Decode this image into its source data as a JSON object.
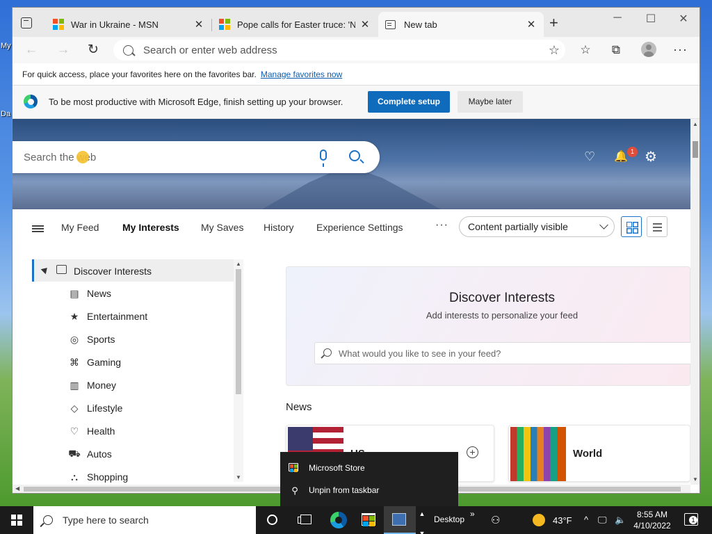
{
  "desktop": {
    "labels": [
      "My",
      "Da"
    ]
  },
  "tabs": [
    {
      "label": "War in Ukraine - MSN",
      "close": "✕"
    },
    {
      "label": "Pope calls for Easter truce: 'No v",
      "close": "✕"
    },
    {
      "label": "New tab",
      "close": "✕"
    }
  ],
  "window_controls": {
    "new_tab": "+",
    "minimize": "─",
    "maximize": "☐",
    "close": "✕"
  },
  "toolbar": {
    "back": "←",
    "forward": "→",
    "refresh": "↻",
    "address_placeholder": "Search or enter web address",
    "add_favorite": "☆",
    "favorites": "☆",
    "collections": "⧉",
    "more": "···"
  },
  "favbar": {
    "text": "For quick access, place your favorites here on the favorites bar.",
    "link": "Manage favorites now"
  },
  "infobar": {
    "message": "To be most productive with Microsoft Edge, finish setting up your browser.",
    "primary": "Complete setup",
    "secondary": "Maybe later"
  },
  "hero": {
    "search_placeholder": "Search the web",
    "rewards_icon": "♡",
    "bell_icon": "🔔",
    "notification_count": "1",
    "settings_icon": "⚙"
  },
  "feednav": {
    "items": [
      "My Feed",
      "My Interests",
      "My Saves",
      "History",
      "Experience Settings"
    ],
    "more": "···",
    "content_visibility": "Content partially visible"
  },
  "sidebar": {
    "header": "Discover Interests",
    "items": [
      {
        "icon": "▤",
        "label": "News"
      },
      {
        "icon": "★",
        "label": "Entertainment"
      },
      {
        "icon": "◎",
        "label": "Sports"
      },
      {
        "icon": "⌘",
        "label": "Gaming"
      },
      {
        "icon": "▥",
        "label": "Money"
      },
      {
        "icon": "◇",
        "label": "Lifestyle"
      },
      {
        "icon": "♡",
        "label": "Health"
      },
      {
        "icon": "⛟",
        "label": "Autos"
      },
      {
        "icon": "⛬",
        "label": "Shopping"
      }
    ]
  },
  "discover": {
    "title": "Discover Interests",
    "subtitle": "Add interests to personalize your feed",
    "search_placeholder": "What would you like to see in your feed?"
  },
  "news": {
    "section": "News",
    "cards": [
      {
        "name": "US",
        "add": "+"
      },
      {
        "name": "World"
      }
    ]
  },
  "jumplist": {
    "items": [
      {
        "label": "Microsoft Store"
      },
      {
        "icon": "⚲",
        "label": "Unpin from taskbar"
      }
    ]
  },
  "taskbar": {
    "search_placeholder": "Type here to search",
    "desktop_label": "Desktop",
    "chevron_more": "»",
    "people_icon": "⚇",
    "temperature": "43°F",
    "tray_up": "^",
    "network_icon": "🖵",
    "volume_icon": "🔈",
    "time": "8:55 AM",
    "date": "4/10/2022",
    "notification_count": "1"
  }
}
